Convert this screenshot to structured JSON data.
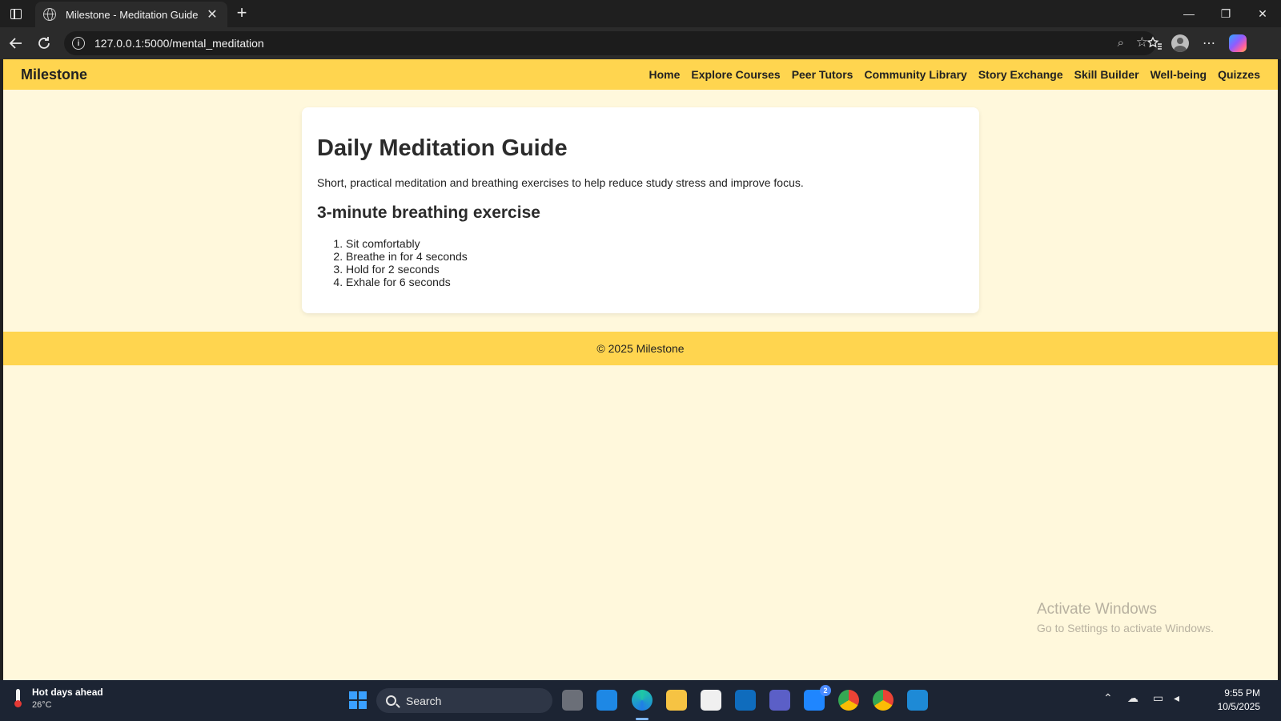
{
  "browser": {
    "tab_title": "Milestone - Meditation Guide",
    "tab_close": "✕",
    "new_tab": "+",
    "url": "127.0.0.1:5000/mental_meditation",
    "window": {
      "minimize": "—",
      "restore": "❐",
      "close": "✕"
    }
  },
  "site": {
    "brand": "Milestone",
    "nav": [
      "Home",
      "Explore Courses",
      "Peer Tutors",
      "Community Library",
      "Story Exchange",
      "Skill Builder",
      "Well-being",
      "Quizzes"
    ],
    "footer": "© 2025 Milestone"
  },
  "content": {
    "title": "Daily Meditation Guide",
    "intro": "Short, practical meditation and breathing exercises to help reduce study stress and improve focus.",
    "section_title": "3-minute breathing exercise",
    "steps": [
      "Sit comfortably",
      "Breathe in for 4 seconds",
      "Hold for 2 seconds",
      "Exhale for 6 seconds"
    ]
  },
  "watermark": {
    "line1": "Activate Windows",
    "line2": "Go to Settings to activate Windows."
  },
  "taskbar": {
    "weather_title": "Hot days ahead",
    "weather_temp": "26°C",
    "search_label": "Search",
    "teams_badge": "2",
    "time": "9:55 PM",
    "date": "10/5/2025"
  },
  "colors": {
    "header_bg": "#ffd54f",
    "page_bg": "#fff8dc",
    "card_bg": "#ffffff"
  }
}
